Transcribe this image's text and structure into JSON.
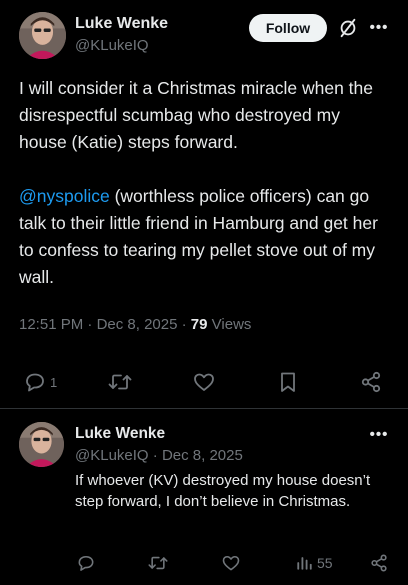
{
  "main_tweet": {
    "author_name": "Luke Wenke",
    "author_handle": "@KLukeIQ",
    "follow_label": "Follow",
    "paragraph1": "I will consider it a Christmas miracle when the disrespectful scumbag who destroyed my house (Katie) steps forward.",
    "mention": "@nyspolice",
    "paragraph2_rest": " (worthless police officers) can go talk to their little friend in Hamburg and get her to confess to tearing my pellet stove out of my wall.",
    "time": "12:51 PM",
    "separator": "·",
    "date": "Dec 8, 2025",
    "views_count": "79",
    "views_label": "Views",
    "reply_count": "1"
  },
  "reply_tweet": {
    "author_name": "Luke Wenke",
    "author_handle": "@KLukeIQ",
    "separator": "·",
    "date": "Dec 8, 2025",
    "text": "If whoever (KV) destroyed my house doesn’t step forward, I don’t believe in Christmas.",
    "views_count": "55"
  },
  "icons": {
    "grok": "grok-slash-icon",
    "more": "more-dots-icon",
    "reply": "reply-bubble-icon",
    "retweet": "retweet-icon",
    "like": "heart-icon",
    "bookmark": "bookmark-icon",
    "share": "share-icon",
    "views": "views-bar-icon"
  },
  "colors": {
    "background": "#000000",
    "text": "#e7e9ea",
    "muted": "#71767b",
    "link": "#1d9bf0",
    "follow_bg": "#eff3f4",
    "divider": "#2f3336"
  }
}
